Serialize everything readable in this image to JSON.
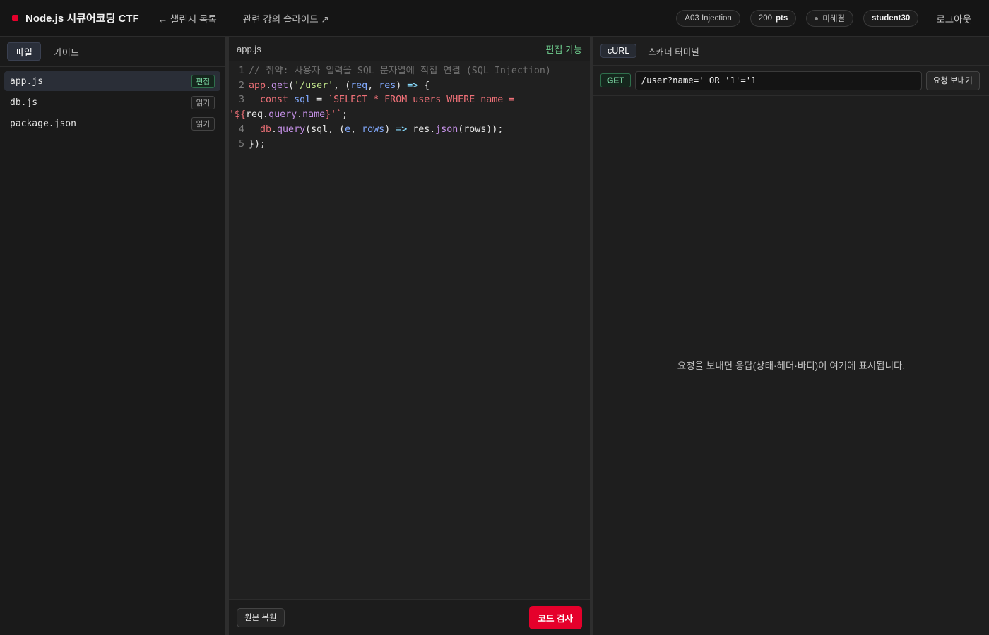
{
  "app": {
    "title": "Node.js 시큐어코딩 CTF",
    "nav_back": "← 챌린지 목록",
    "nav_slides": "관련 강의 슬라이드 ↗"
  },
  "status": {
    "category": "A03 Injection",
    "points_value": "200",
    "points_unit": "pts",
    "solved_state": "미해결",
    "username": "student30",
    "logout": "로그아웃"
  },
  "sidebar": {
    "tabs": [
      {
        "label": "파일",
        "active": true
      },
      {
        "label": "가이드",
        "active": false
      }
    ],
    "files": [
      {
        "name": "app.js",
        "badge": "편집",
        "active": true
      },
      {
        "name": "db.js",
        "badge": "읽기",
        "active": false
      },
      {
        "name": "package.json",
        "badge": "읽기",
        "active": false
      }
    ]
  },
  "editor": {
    "filename": "app.js",
    "editable_label": "편집 가능",
    "line_numbers": [
      "1",
      "2",
      "3",
      "4",
      "5"
    ],
    "restore_label": "원본 복원",
    "check_label": "코드 검사"
  },
  "right": {
    "tabs": [
      {
        "label": "cURL",
        "active": true
      },
      {
        "label": "스캐너 터미널",
        "active": false
      }
    ],
    "method": "GET",
    "url_value": "/user?name=' OR '1'='1",
    "send_label": "요청 보내기",
    "placeholder": "요청을 보내면 응답(상태·헤더·바디)이 여기에 표시됩니다."
  },
  "colors": {
    "brand": "#e5002b",
    "editable_green": "#6fcf8f",
    "background": "#1a1a1a"
  }
}
